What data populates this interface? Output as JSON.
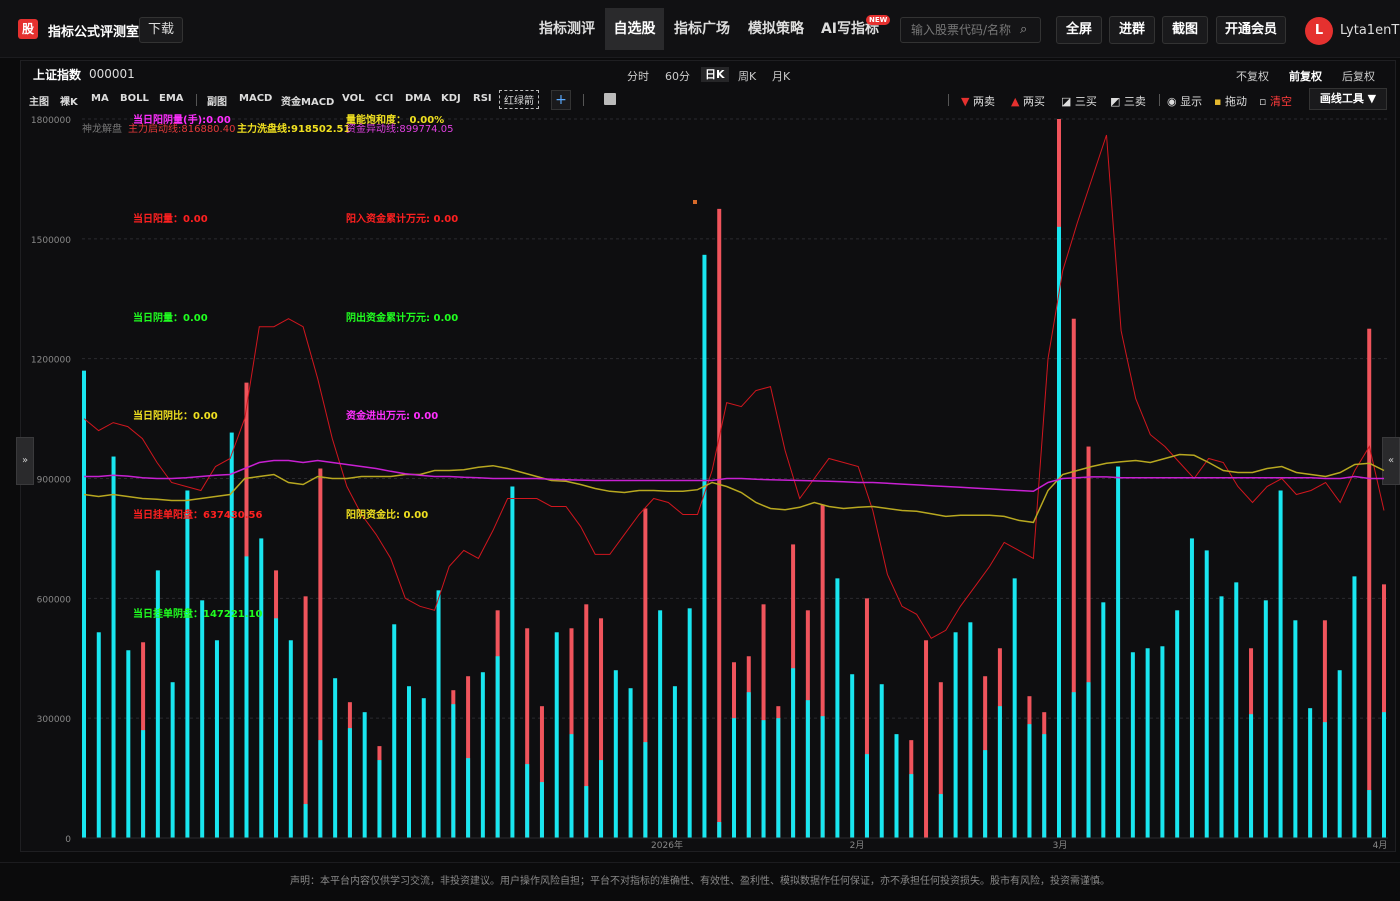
{
  "app": {
    "logo_char": "股",
    "title": "指标公式评测室",
    "download_label": "下载"
  },
  "nav": [
    {
      "label": "指标测评",
      "active": false
    },
    {
      "label": "自选股",
      "active": true
    },
    {
      "label": "指标广场",
      "active": false
    },
    {
      "label": "模拟策略",
      "active": false
    },
    {
      "label": "AI写指标",
      "active": false
    }
  ],
  "new_badge": "NEW",
  "search": {
    "placeholder": "输入股票代码/名称"
  },
  "toolbar_buttons": [
    "全屏",
    "进群",
    "截图",
    "开通会员"
  ],
  "user": {
    "initial": "L",
    "name": "Lyta1enT"
  },
  "stock": {
    "name": "上证指数",
    "code": "000001"
  },
  "periods": [
    {
      "label": "分时",
      "active": false
    },
    {
      "label": "60分",
      "active": false
    },
    {
      "label": "日K",
      "active": true
    },
    {
      "label": "周K",
      "active": false
    },
    {
      "label": "月K",
      "active": false
    }
  ],
  "adjust": [
    {
      "label": "不复权",
      "active": false
    },
    {
      "label": "前复权",
      "active": true
    },
    {
      "label": "后复权",
      "active": false
    }
  ],
  "indicators": [
    "主图",
    "裸K",
    "MA",
    "BOLL",
    "EMA",
    "副图",
    "MACD",
    "资金MACD",
    "VOL",
    "CCI",
    "DMA",
    "KDJ",
    "RSI"
  ],
  "indicator_dashed": "红绿箭",
  "plus_label": "+",
  "tools": [
    "两卖",
    "两买",
    "三买",
    "三卖",
    "显示",
    "拖动",
    "清空"
  ],
  "draw_tool": "画线工具 ▼",
  "side_left": "»",
  "side_right": "«",
  "overlay": {
    "l1": "当日阳阴量(手):0.00",
    "l2": "神龙解盘",
    "l3": "主力启动线:816880.40",
    "l4": "主力洗盘线:918502.51",
    "l5": "量能饱和度：  0.00%",
    "l6": "资金异动线:899774.05",
    "t1": "当日阳量：0.00",
    "t2": "阳入资金累计万元: 0.00",
    "t3": "当日阴量：0.00",
    "t4": "阴出资金累计万元: 0.00",
    "t5": "当日阳阴比：0.00",
    "t6": "资金进出万元: 0.00",
    "t7": "当日挂单阳盘：637430.56",
    "t8": "阳阴资金比: 0.00",
    "t9": "当日挂单阴盘：147221.10"
  },
  "colors": {
    "cyan": "#19e6f0",
    "red": "#f0545c",
    "purple": "#c820d2",
    "olive": "#b8a820",
    "redline": "#d0161e"
  },
  "chart_data": {
    "type": "bar",
    "yticks": [
      "1800000",
      "1500000",
      "1200000",
      "900000",
      "600000",
      "300000",
      "0"
    ],
    "ylim": [
      0,
      1800000
    ],
    "xticks": [
      "2026年",
      "2月",
      "3月",
      "4月"
    ],
    "bars": [
      {
        "c": 1170000,
        "r": 0
      },
      {
        "c": 515000,
        "r": 0
      },
      {
        "c": 955000,
        "r": 0
      },
      {
        "c": 470000,
        "r": 0
      },
      {
        "c": 270000,
        "r": 490000
      },
      {
        "c": 670000,
        "r": 0
      },
      {
        "c": 390000,
        "r": 0
      },
      {
        "c": 870000,
        "r": 0
      },
      {
        "c": 595000,
        "r": 0
      },
      {
        "c": 495000,
        "r": 0
      },
      {
        "c": 1015000,
        "r": 0
      },
      {
        "c": 705000,
        "r": 1140000
      },
      {
        "c": 750000,
        "r": 0
      },
      {
        "c": 550000,
        "r": 670000
      },
      {
        "c": 495000,
        "r": 0
      },
      {
        "c": 85000,
        "r": 605000
      },
      {
        "c": 245000,
        "r": 925000
      },
      {
        "c": 400000,
        "r": 0
      },
      {
        "c": 275000,
        "r": 340000
      },
      {
        "c": 315000,
        "r": 0
      },
      {
        "c": 195000,
        "r": 230000
      },
      {
        "c": 535000,
        "r": 0
      },
      {
        "c": 380000,
        "r": 0
      },
      {
        "c": 350000,
        "r": 0
      },
      {
        "c": 620000,
        "r": 0
      },
      {
        "c": 335000,
        "r": 370000
      },
      {
        "c": 200000,
        "r": 405000
      },
      {
        "c": 415000,
        "r": 0
      },
      {
        "c": 455000,
        "r": 570000
      },
      {
        "c": 880000,
        "r": 0
      },
      {
        "c": 185000,
        "r": 525000
      },
      {
        "c": 140000,
        "r": 330000
      },
      {
        "c": 515000,
        "r": 0
      },
      {
        "c": 260000,
        "r": 525000
      },
      {
        "c": 130000,
        "r": 585000
      },
      {
        "c": 195000,
        "r": 550000
      },
      {
        "c": 420000,
        "r": 0
      },
      {
        "c": 375000,
        "r": 0
      },
      {
        "c": 240000,
        "r": 825000
      },
      {
        "c": 570000,
        "r": 0
      },
      {
        "c": 380000,
        "r": 0
      },
      {
        "c": 575000,
        "r": 0
      },
      {
        "c": 1460000,
        "r": 0
      },
      {
        "c": 40000,
        "r": 1575000
      },
      {
        "c": 300000,
        "r": 440000
      },
      {
        "c": 365000,
        "r": 455000
      },
      {
        "c": 295000,
        "r": 585000
      },
      {
        "c": 300000,
        "r": 330000
      },
      {
        "c": 425000,
        "r": 735000
      },
      {
        "c": 345000,
        "r": 570000
      },
      {
        "c": 305000,
        "r": 835000
      },
      {
        "c": 650000,
        "r": 0
      },
      {
        "c": 410000,
        "r": 0
      },
      {
        "c": 210000,
        "r": 600000
      },
      {
        "c": 385000,
        "r": 0
      },
      {
        "c": 260000,
        "r": 0
      },
      {
        "c": 160000,
        "r": 245000
      },
      {
        "c": 0,
        "r": 495000
      },
      {
        "c": 110000,
        "r": 390000
      },
      {
        "c": 515000,
        "r": 0
      },
      {
        "c": 540000,
        "r": 0
      },
      {
        "c": 220000,
        "r": 405000
      },
      {
        "c": 330000,
        "r": 475000
      },
      {
        "c": 650000,
        "r": 0
      },
      {
        "c": 285000,
        "r": 355000
      },
      {
        "c": 260000,
        "r": 315000
      },
      {
        "c": 1530000,
        "r": 1800000
      },
      {
        "c": 365000,
        "r": 1300000
      },
      {
        "c": 390000,
        "r": 980000
      },
      {
        "c": 590000,
        "r": 0
      },
      {
        "c": 930000,
        "r": 0
      },
      {
        "c": 465000,
        "r": 0
      },
      {
        "c": 475000,
        "r": 0
      },
      {
        "c": 480000,
        "r": 0
      },
      {
        "c": 570000,
        "r": 0
      },
      {
        "c": 750000,
        "r": 0
      },
      {
        "c": 720000,
        "r": 0
      },
      {
        "c": 605000,
        "r": 0
      },
      {
        "c": 640000,
        "r": 0
      },
      {
        "c": 310000,
        "r": 475000
      },
      {
        "c": 595000,
        "r": 0
      },
      {
        "c": 870000,
        "r": 0
      },
      {
        "c": 545000,
        "r": 0
      },
      {
        "c": 325000,
        "r": 0
      },
      {
        "c": 290000,
        "r": 545000
      },
      {
        "c": 420000,
        "r": 0
      },
      {
        "c": 655000,
        "r": 0
      },
      {
        "c": 120000,
        "r": 1275000
      },
      {
        "c": 315000,
        "r": 635000
      }
    ],
    "series": [
      {
        "key": "redline",
        "values": [
          1050000,
          1020000,
          1040000,
          1030000,
          1000000,
          940000,
          890000,
          880000,
          870000,
          930000,
          950000,
          1050000,
          1280000,
          1280000,
          1300000,
          1280000,
          1150000,
          1000000,
          880000,
          810000,
          760000,
          700000,
          600000,
          580000,
          570000,
          680000,
          720000,
          700000,
          770000,
          850000,
          850000,
          850000,
          830000,
          830000,
          780000,
          710000,
          710000,
          760000,
          810000,
          850000,
          840000,
          810000,
          810000,
          920000,
          1090000,
          1080000,
          1120000,
          1130000,
          970000,
          850000,
          900000,
          950000,
          940000,
          930000,
          820000,
          660000,
          580000,
          560000,
          500000,
          520000,
          580000,
          630000,
          680000,
          740000,
          720000,
          700000,
          1200000,
          1420000,
          1540000,
          1650000,
          1760000,
          1270000,
          1100000,
          1010000,
          980000,
          940000,
          900000,
          950000,
          940000,
          880000,
          840000,
          880000,
          900000,
          860000,
          870000,
          890000,
          840000,
          920000,
          980000,
          820000
        ]
      },
      {
        "key": "olive",
        "values": [
          860000,
          855000,
          860000,
          855000,
          850000,
          848000,
          845000,
          845000,
          850000,
          855000,
          860000,
          900000,
          905000,
          910000,
          890000,
          885000,
          905000,
          900000,
          900000,
          905000,
          905000,
          905000,
          910000,
          910000,
          920000,
          920000,
          922000,
          928000,
          932000,
          925000,
          915000,
          905000,
          895000,
          893000,
          885000,
          875000,
          868000,
          865000,
          870000,
          870000,
          868000,
          868000,
          872000,
          890000,
          880000,
          865000,
          840000,
          825000,
          822000,
          828000,
          840000,
          830000,
          825000,
          828000,
          830000,
          825000,
          820000,
          818000,
          812000,
          805000,
          808000,
          808000,
          808000,
          805000,
          795000,
          790000,
          870000,
          910000,
          920000,
          930000,
          938000,
          942000,
          945000,
          940000,
          950000,
          960000,
          958000,
          940000,
          920000,
          915000,
          915000,
          925000,
          930000,
          915000,
          910000,
          905000,
          915000,
          935000,
          938000,
          920000
        ]
      },
      {
        "key": "purple",
        "values": [
          905000,
          905000,
          908000,
          906000,
          902000,
          900000,
          900000,
          902000,
          905000,
          908000,
          910000,
          925000,
          940000,
          945000,
          945000,
          940000,
          945000,
          940000,
          935000,
          930000,
          925000,
          918000,
          912000,
          908000,
          905000,
          905000,
          903000,
          902000,
          900000,
          900000,
          900000,
          900000,
          898000,
          897000,
          896000,
          895000,
          895000,
          895000,
          895000,
          895000,
          895000,
          895000,
          895000,
          895000,
          900000,
          900000,
          898000,
          897000,
          896000,
          895000,
          894000,
          893000,
          892000,
          890000,
          890000,
          888000,
          886000,
          884000,
          882000,
          880000,
          878000,
          876000,
          874000,
          872000,
          870000,
          868000,
          890000,
          900000,
          902000,
          904000,
          904000,
          902000,
          902000,
          902000,
          902000,
          902000,
          902000,
          902000,
          902000,
          902000,
          902000,
          902000,
          902000,
          902000,
          902000,
          900000,
          900000,
          905000,
          900000,
          900000
        ]
      }
    ]
  },
  "footer": "声明：本平台内容仅供学习交流，非投资建议。用户操作风险自担；平台不对指标的准确性、有效性、盈利性、模拟数据作任何保证，亦不承担任何投资损失。股市有风险，投资需谨慎。"
}
